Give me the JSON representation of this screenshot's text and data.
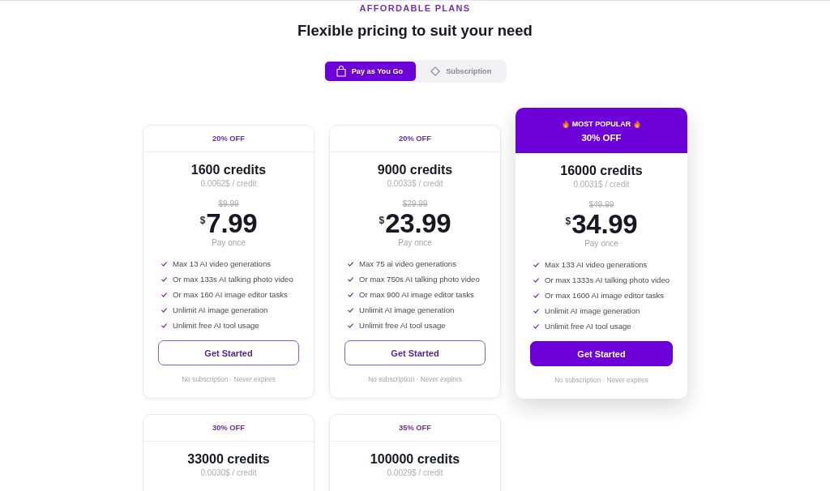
{
  "header": {
    "eyebrow": "AFFORDABLE PLANS",
    "title": "Flexible pricing to suit your need"
  },
  "billing_toggle": [
    {
      "label": "Pay as You Go",
      "selected": true
    },
    {
      "label": "Subscription",
      "selected": false
    }
  ],
  "plans": [
    {
      "highlighted": false,
      "discount": "20% OFF",
      "credits": "1600 credits",
      "per_credit": "0.0062$ / credit",
      "old_price": "$9.99",
      "currency": "$",
      "price": "7.99",
      "billing": "Pay once",
      "features": [
        "Max 13 AI video generations",
        "Or max 133s AI talking photo video",
        "Or max 160 AI image editor tasks",
        "Unlimit AI image generation",
        "Unlimit free AI tool usage"
      ],
      "button": "Get Started",
      "note": "No subscription · Never expires"
    },
    {
      "highlighted": false,
      "discount": "20% OFF",
      "credits": "9000 credits",
      "per_credit": "0.0033$ / credit",
      "old_price": "$29.99",
      "currency": "$",
      "price": "23.99",
      "billing": "Pay once",
      "features": [
        "Max 75 ai video generations",
        "Or max 750s AI talking photo video",
        "Or max 900 AI image editor tasks",
        "Unlimit AI image generation",
        "Unlimit free AI tool usage"
      ],
      "button": "Get Started",
      "note": "No subscription · Never expires"
    },
    {
      "highlighted": true,
      "badge": "MOST POPULAR",
      "discount": "30% OFF",
      "credits": "16000 credits",
      "per_credit": "0.0031$ / credit",
      "old_price": "$49.99",
      "currency": "$",
      "price": "34.99",
      "billing": "Pay once",
      "features": [
        "Max 133 AI video generations",
        "Or max 1333s AI talking photo video",
        "Or max 1600 AI image editor tasks",
        "Unlimit AI image generation",
        "Unlimit free AI tool usage"
      ],
      "button": "Get Started",
      "note": "No subscription · Never expires"
    },
    {
      "highlighted": false,
      "discount": "30% OFF",
      "credits": "33000 credits",
      "per_credit": "0.0030$ / credit"
    },
    {
      "highlighted": false,
      "discount": "35% OFF",
      "credits": "100000 credits",
      "per_credit": "0.0029$ / credit"
    }
  ]
}
